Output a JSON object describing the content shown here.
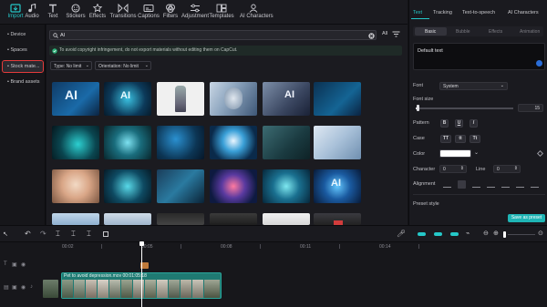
{
  "toolbar": {
    "tabs": [
      {
        "label": "Import",
        "icon": "import-icon",
        "active": true
      },
      {
        "label": "Audio",
        "icon": "audio-icon"
      },
      {
        "label": "Text",
        "icon": "text-icon"
      },
      {
        "label": "Stickers",
        "icon": "stickers-icon"
      },
      {
        "label": "Effects",
        "icon": "effects-icon"
      },
      {
        "label": "Transitions",
        "icon": "transitions-icon"
      },
      {
        "label": "Captions",
        "icon": "captions-icon"
      },
      {
        "label": "Filters",
        "icon": "filters-icon"
      },
      {
        "label": "Adjustment",
        "icon": "adjustment-icon"
      },
      {
        "label": "Templates",
        "icon": "templates-icon"
      },
      {
        "label": "AI Characters",
        "icon": "ai-characters-icon"
      }
    ]
  },
  "left_panel": {
    "items": [
      "• Device",
      "• Spaces",
      "• Stock mate...",
      "• Brand assets"
    ]
  },
  "media": {
    "search_value": "AI",
    "search_scope": "All",
    "notice": "To avoid copyright infringement, do not export materials without editing them on CapCut.",
    "filter_type": "Type: No limit",
    "filter_orientation": "Orientation: No limit",
    "thumb_texts": [
      "AI",
      "AI",
      "AI",
      "AI"
    ]
  },
  "right_panel": {
    "tabs": [
      "Text",
      "Tracking",
      "Text-to-speech",
      "AI Characters"
    ],
    "subtabs": [
      "Basic",
      "Bubble",
      "Effects",
      "Animation"
    ],
    "default_text": "Default text",
    "font_label": "Font",
    "font_value": "System",
    "font_size_label": "Font size",
    "font_size_value": "15",
    "pattern_label": "Pattern",
    "pattern_buttons": [
      "B",
      "U",
      "I"
    ],
    "case_label": "Case",
    "case_buttons": [
      "TT",
      "tt",
      "Tt"
    ],
    "color_label": "Color",
    "character_label": "Character",
    "character_value": "0",
    "line_label": "Line",
    "line_value": "0",
    "alignment_label": "Alignment",
    "preset_label": "Preset style",
    "save_preset": "Save as preset",
    "accent": "#25c8c8"
  },
  "timeline": {
    "ticks": [
      "00:02",
      "00:05",
      "00:08",
      "00:11",
      "00:14"
    ],
    "clip_label": "Pet to avoid depression.mov  00:01:05:18",
    "clip_color": "#1f7a72"
  }
}
